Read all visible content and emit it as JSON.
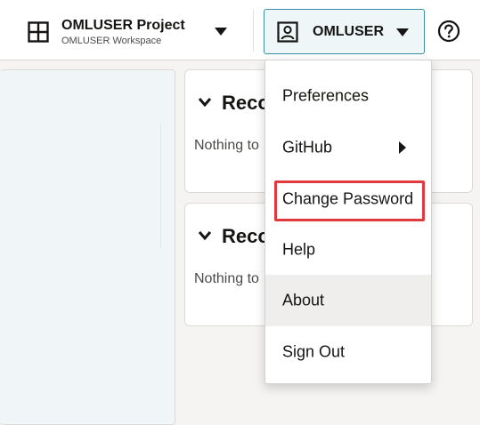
{
  "header": {
    "project_name": "OMLUSER Project",
    "workspace_name": "OMLUSER Workspace",
    "user_label": "OMLUSER",
    "icons": {
      "project": "grid-icon",
      "project_caret": "chevron-down-icon",
      "user": "user-icon",
      "user_caret": "chevron-down-icon",
      "help": "help-icon"
    }
  },
  "cards": [
    {
      "title": "Reco",
      "empty_text": "Nothing to"
    },
    {
      "title": "Reco",
      "empty_text": "Nothing to"
    }
  ],
  "user_menu": {
    "items": [
      {
        "label": "Preferences"
      },
      {
        "label": "GitHub",
        "has_submenu": true
      },
      {
        "label": "Change Password",
        "highlighted": true
      },
      {
        "label": "Help"
      },
      {
        "label": "About",
        "hovered": true
      },
      {
        "label": "Sign Out"
      }
    ]
  },
  "colors": {
    "accent": "#3a8fa8",
    "highlight": "#e0393e",
    "hover_bg": "#efeeec"
  }
}
